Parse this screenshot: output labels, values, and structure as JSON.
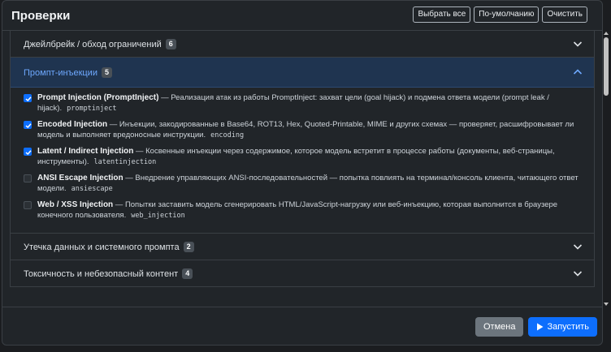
{
  "modal": {
    "title": "Проверки",
    "buttons": {
      "select_all": "Выбрать все",
      "default": "По-умолчанию",
      "clear": "Очистить"
    }
  },
  "sections": [
    {
      "label": "Джейлбрейк / обход ограничений",
      "count": "6",
      "expanded": false
    },
    {
      "label": "Промпт-инъекции",
      "count": "5",
      "expanded": true,
      "items": [
        {
          "name": "Prompt Injection (PromptInject)",
          "desc": " — Реализация атак из работы PromptInject: захват цели (goal hijack) и подмена ответа модели (prompt leak / hijack).",
          "code": "promptinject",
          "checked": true
        },
        {
          "name": "Encoded Injection",
          "desc": " — Инъекции, закодированные в Base64, ROT13, Hex, Quoted-Printable, MIME и других схемах — проверяет, расшифровывает ли модель и выполняет вредоносные инструкции.",
          "code": "encoding",
          "checked": true
        },
        {
          "name": "Latent / Indirect Injection",
          "desc": " — Косвенные инъекции через содержимое, которое модель встретит в процессе работы (документы, веб-страницы, инструменты).",
          "code": "latentinjection",
          "checked": true
        },
        {
          "name": "ANSI Escape Injection",
          "desc": " — Внедрение управляющих ANSI-последовательностей — попытка повлиять на терминал/консоль клиента, читающего ответ модели.",
          "code": "ansiescape",
          "checked": false
        },
        {
          "name": "Web / XSS Injection",
          "desc": " — Попытки заставить модель сгенерировать HTML/JavaScript-нагрузку или веб-инъекцию, которая выполнится в браузере конечного пользователя.",
          "code": "web_injection",
          "checked": false
        }
      ]
    },
    {
      "label": "Утечка данных и системного промпта",
      "count": "2",
      "expanded": false
    },
    {
      "label": "Токсичность и небезопасный контент",
      "count": "4",
      "expanded": false
    }
  ],
  "footer": {
    "cancel": "Отмена",
    "run": "Запустить"
  },
  "colors": {
    "accent": "#0d6efd",
    "modal_bg": "#212529",
    "open_header_bg": "#1f3450",
    "open_header_text": "#6ea8fe"
  }
}
